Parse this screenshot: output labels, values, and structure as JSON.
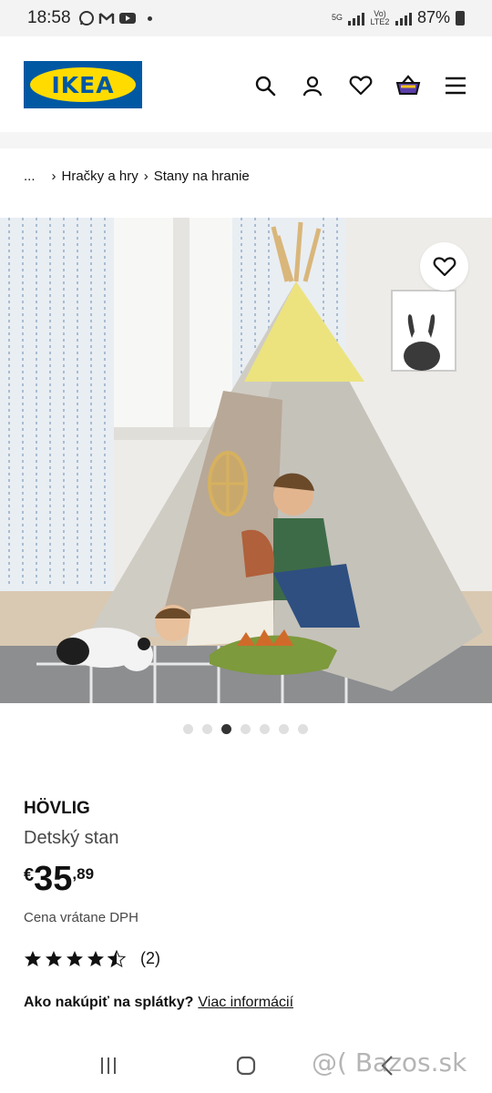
{
  "status_bar": {
    "time": "18:58",
    "network": "5G",
    "lte": "Vo) LTE2",
    "battery": "87%"
  },
  "header": {
    "logo_text": "IKEA",
    "icons": [
      "search-icon",
      "user-icon",
      "heart-icon",
      "cart-icon",
      "menu-icon"
    ]
  },
  "breadcrumb": {
    "items": [
      "...",
      "Hračky a hry",
      "Stany na hranie"
    ]
  },
  "gallery": {
    "image_count": 7,
    "active_index": 2
  },
  "product": {
    "name": "HÖVLIG",
    "description": "Detský stan",
    "price_currency": "€",
    "price_integer": "35",
    "price_decimal": ",89",
    "vat_note": "Cena vrátane DPH",
    "rating_stars": 4.5,
    "review_count": "(2)",
    "installment_question": "Ako nakúpiť na splátky?",
    "installment_link": "Viac informácií"
  },
  "watermark": "@( Bazos.sk",
  "colors": {
    "ikea_blue": "#0058a3",
    "ikea_yellow": "#ffdb00"
  }
}
